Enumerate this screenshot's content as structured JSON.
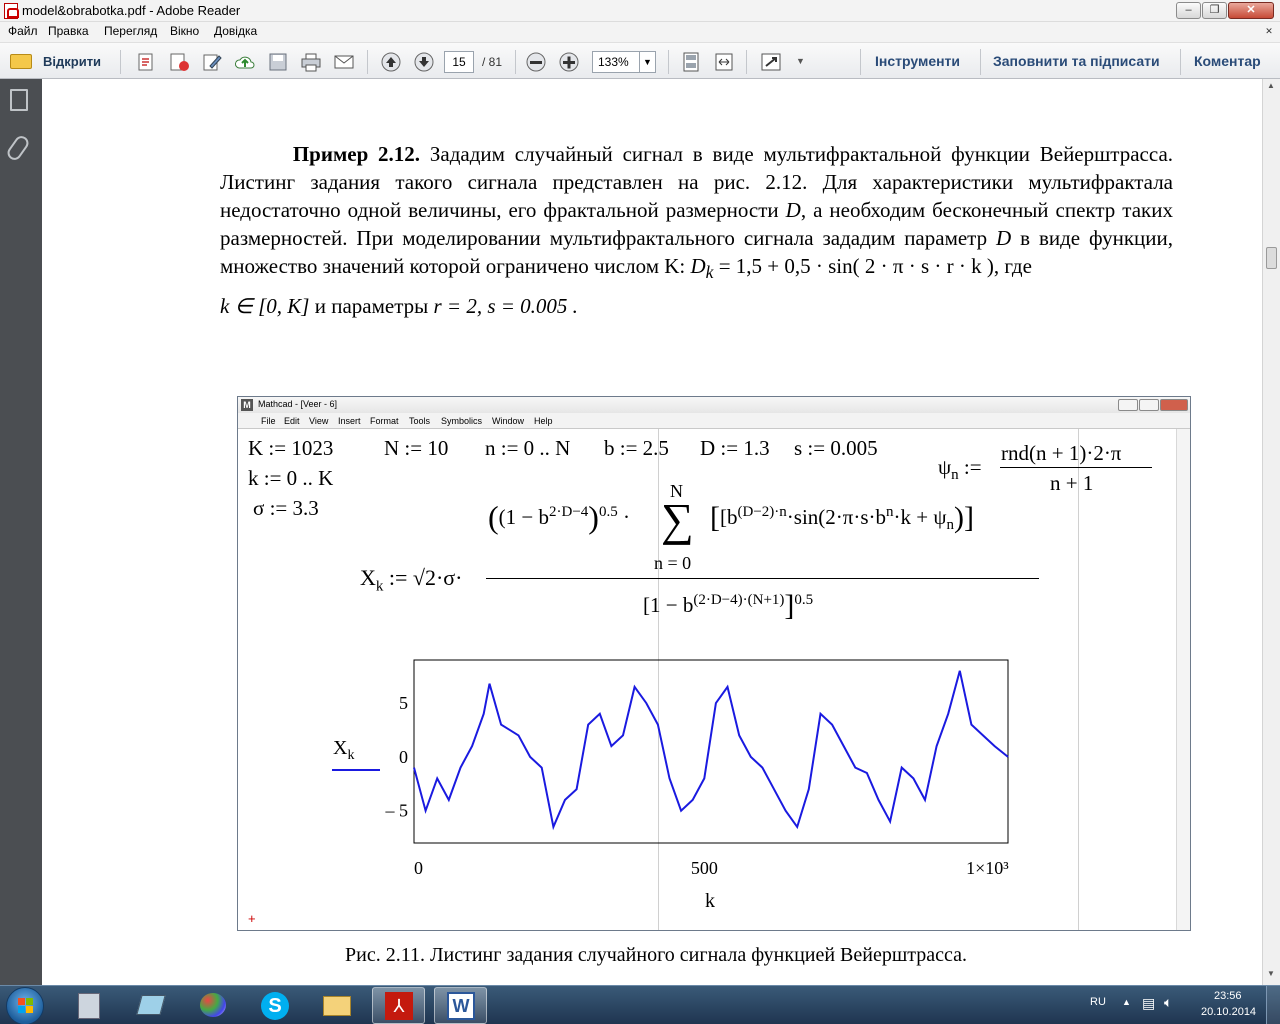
{
  "window": {
    "title": "model&obrabotka.pdf - Adobe Reader"
  },
  "menu": [
    "Файл",
    "Правка",
    "Перегляд",
    "Вікно",
    "Довідка"
  ],
  "toolbar": {
    "open_label": "Відкрити",
    "page_current": "15",
    "page_total": "/ 81",
    "zoom": "133%",
    "tools_label": "Інструменти",
    "fill_sign_label": "Заповнити та підписати",
    "comment_label": "Коментар"
  },
  "document": {
    "example_label": "Пример 2.12.",
    "para_text": "Зададим случайный сигнал в виде мультифрактальной функции Вейерштрасса. Листинг задания такого сигнала представлен на рис. 2.12. Для характеристики мультифрактала недостаточно одной величины, его фрактальной размерности",
    "para_D": "D",
    "para_text2": ", а необходим бесконечный спектр таких размерностей. При моделировании мультифрактального сигнала зададим параметр",
    "para_text3": "в виде функции, множество значений которой ограничено числом K:",
    "formula_Dk": "D",
    "formula_Dk_sub": "k",
    "formula_Dk_rhs": " = 1,5 + 0,5 · sin( 2 · π · s · r · k )",
    "formula_where": ",  где",
    "k_range": "k ∈ [0, K]",
    "params_text": " и параметры ",
    "params_values": "r = 2, s = 0.005 .",
    "caption": "Рис. 2.11. Листинг задания случайного сигнала функцией Вейерштрасса."
  },
  "mathcad": {
    "title": "Mathcad - [Veer - 6]",
    "menu": [
      "File",
      "Edit",
      "View",
      "Insert",
      "Format",
      "Tools",
      "Symbolics",
      "Window",
      "Help"
    ],
    "def_K": "K := 1023",
    "def_N": "N := 10",
    "def_n": "n := 0 .. N",
    "def_b": "b := 2.5",
    "def_D": "D := 1.3",
    "def_s": "s := 0.005",
    "def_k": "k := 0 .. K",
    "def_sigma": "σ := 3.3",
    "psi_lhs": "ψ",
    "psi_sub": "n",
    "psi_assign": ":=",
    "psi_num": "rnd(n + 1)·2·π",
    "psi_den": "n + 1",
    "xk_lhs": "X",
    "xk_sub": "k",
    "xk_assign": ":= √2·σ·",
    "sum_top": "N",
    "sum_bottom": "n = 0",
    "numer_left": "(1 − b",
    "numer_left_exp": "2·D−4",
    "numer_left_close": ")",
    "numer_left_pow": "0.5",
    "numer_dot": "·",
    "numer_right": "[b",
    "numer_right_exp": "(D−2)·n",
    "numer_right_tail": "·sin(2·π·s·b",
    "numer_right_exp2": "n",
    "numer_right_end": "·k + ψ",
    "numer_right_sub": "n",
    "numer_right_close": ")]",
    "denom": "[1 − b",
    "denom_exp": "(2·D−4)·(N+1)",
    "denom_close": "]",
    "denom_pow": "0.5",
    "plot_legend": "X",
    "plot_legend_sub": "k"
  },
  "chart_data": {
    "type": "line",
    "xlabel": "k",
    "ylabel": "X_k",
    "xlim": [
      0,
      1023
    ],
    "ylim": [
      -8,
      9
    ],
    "x_ticks": [
      "0",
      "500",
      "1×10³"
    ],
    "y_ticks": [
      "5",
      "0",
      "– 5"
    ],
    "grid": false,
    "series": [
      {
        "name": "X_k",
        "color": "#1a1ae0",
        "x": [
          0,
          20,
          40,
          60,
          80,
          100,
          120,
          130,
          150,
          180,
          200,
          220,
          240,
          260,
          280,
          300,
          320,
          340,
          360,
          380,
          400,
          420,
          440,
          460,
          480,
          500,
          520,
          540,
          560,
          580,
          600,
          620,
          640,
          660,
          680,
          700,
          720,
          740,
          760,
          780,
          800,
          820,
          840,
          860,
          880,
          900,
          920,
          940,
          960,
          980,
          1000,
          1023
        ],
        "values": [
          -1,
          -5,
          -2,
          -4,
          -1,
          1,
          4,
          6.8,
          3,
          2,
          0,
          -1,
          -6.5,
          -4,
          -3,
          3,
          4,
          1,
          2,
          6.5,
          5,
          3,
          -2,
          -5,
          -4,
          -2,
          5,
          6.5,
          2,
          0,
          -1,
          -3,
          -5,
          -6.5,
          -3,
          4,
          3,
          1,
          -1,
          -1.5,
          -4,
          -6,
          -1,
          -2,
          -4,
          1,
          4,
          8,
          3,
          2,
          1,
          0
        ]
      }
    ]
  }
}
